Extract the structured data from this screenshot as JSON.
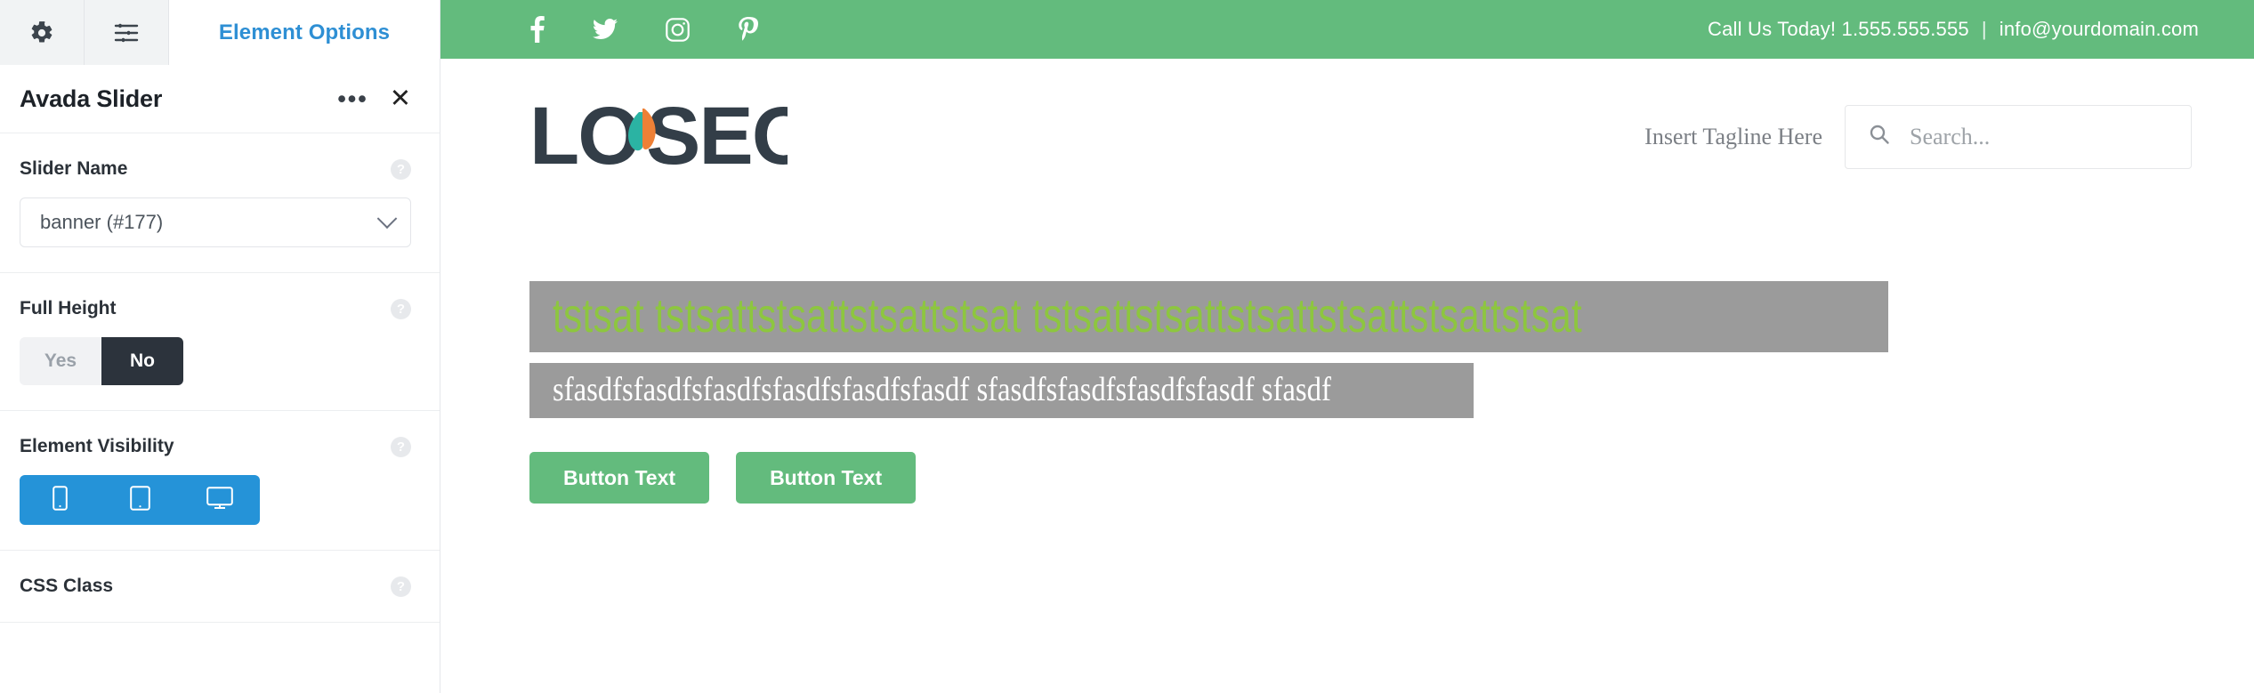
{
  "sidebar": {
    "tabs": [
      {
        "icon": "gear-icon",
        "label": ""
      },
      {
        "icon": "sliders-icon",
        "label": ""
      }
    ],
    "active_tab_label": "Element Options",
    "panel": {
      "title": "Avada Slider",
      "more_label": "•••",
      "close_label": "✕"
    },
    "help_label": "?",
    "fields": [
      {
        "label": "Slider Name",
        "type": "select",
        "value": "banner (#177)"
      },
      {
        "label": "Full Height",
        "type": "toggle",
        "options": [
          "Yes",
          "No"
        ],
        "selected": "No"
      },
      {
        "label": "Element Visibility",
        "type": "visibility",
        "devices": [
          "mobile-icon",
          "tablet-icon",
          "desktop-icon"
        ],
        "accent": "#2593d8"
      },
      {
        "label": "CSS Class",
        "type": "text",
        "value": ""
      }
    ]
  },
  "preview": {
    "topbar": {
      "background": "#63bb7d",
      "socials": [
        "facebook-icon",
        "twitter-icon",
        "instagram-icon",
        "pinterest-icon"
      ],
      "call_text": "Call Us Today! 1.555.555.555",
      "separator": "|",
      "email": "info@yourdomain.com"
    },
    "header": {
      "logo_text": "LOYSEO",
      "logo_colors": {
        "text": "#333e48",
        "leaf_left": "#2bb3a3",
        "leaf_right": "#ee8036"
      },
      "tagline": "Insert Tagline Here",
      "search_placeholder": "Search...",
      "search_value": ""
    },
    "slider": {
      "heading": "tstsat tstsattstsattstsattstsat tstsattstsattstsattstsattstsattstsat",
      "heading_color": "#8dc63f",
      "subheading": "sfasdfsfasdfsfasdfsfasdfsfasdfsfasdf sfasdfsfasdfsfasdfsfasdf sfasdf",
      "subheading_color": "#ffffff",
      "band_background": "#9b9b9b",
      "buttons": [
        {
          "label": "Button Text"
        },
        {
          "label": "Button Text"
        }
      ],
      "button_color": "#63bb7d"
    }
  }
}
